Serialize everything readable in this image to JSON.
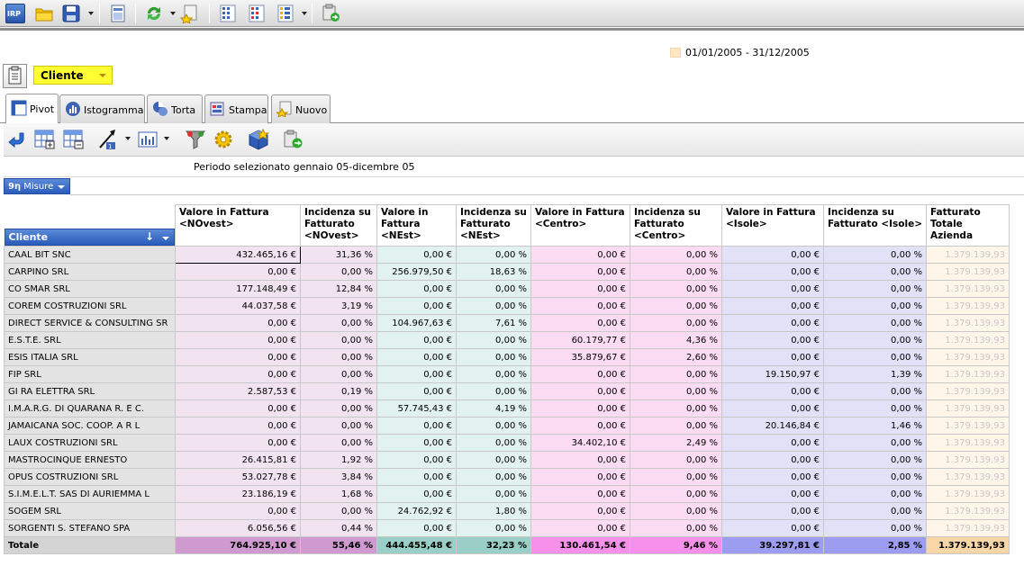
{
  "toolbar": {
    "icons": [
      "irp-logo-icon",
      "open-folder-icon",
      "save-icon",
      "document-icon",
      "refresh-icon",
      "new-star-icon",
      "grid-blue-icon",
      "grid-red-icon",
      "grid-yellow-icon",
      "export-icon"
    ],
    "irp_label": "IRP"
  },
  "period_legend": "01/01/2005 - 31/12/2005",
  "dimension": {
    "selected": "Cliente"
  },
  "tabs": [
    {
      "label": "Pivot",
      "icon": "pivot-table-icon",
      "active": true
    },
    {
      "label": "Istogramma",
      "icon": "bar-chart-icon"
    },
    {
      "label": "Torta",
      "icon": "pie-chart-icon"
    },
    {
      "label": "Stampa",
      "icon": "print-icon"
    },
    {
      "label": "Nuovo",
      "icon": "new-star-icon"
    }
  ],
  "pivot_toolbar_icons": [
    "back-arrow-icon",
    "add-column-icon",
    "remove-column-icon",
    "drill-icon",
    "chart-options-icon",
    "filter-icon",
    "settings-gear-icon",
    "cube-icon",
    "export-icon"
  ],
  "period_text": "Periodo selezionato  gennaio 05-dicembre 05",
  "measures_label": "Misure",
  "measures_prefix": "9η",
  "grid": {
    "dimension_header": "Cliente",
    "columns": [
      "Valore in Fattura <NOvest>",
      "Incidenza su Fatturato <NOvest>",
      "Valore in Fattura <NEst>",
      "Incidenza su Fatturato <NEst>",
      "Valore in Fattura <Centro>",
      "Incidenza su Fatturato <Centro>",
      "Valore in Fattura <Isole>",
      "Incidenza su Fatturato <Isole>",
      "Fatturato Totale Azienda"
    ],
    "rows": [
      {
        "name": "CAAL BIT SNC",
        "values": [
          "432.465,16 €",
          "31,36 %",
          "0,00 €",
          "0,00 %",
          "0,00 €",
          "0,00 %",
          "0,00 €",
          "0,00 %",
          "1.379.139,93"
        ]
      },
      {
        "name": "CARPINO SRL",
        "values": [
          "0,00 €",
          "0,00 %",
          "256.979,50 €",
          "18,63 %",
          "0,00 €",
          "0,00 %",
          "0,00 €",
          "0,00 %",
          "1.379.139,93"
        ]
      },
      {
        "name": "CO SMAR SRL",
        "values": [
          "177.148,49 €",
          "12,84 %",
          "0,00 €",
          "0,00 %",
          "0,00 €",
          "0,00 %",
          "0,00 €",
          "0,00 %",
          "1.379.139,93"
        ]
      },
      {
        "name": "COREM COSTRUZIONI SRL",
        "values": [
          "44.037,58 €",
          "3,19 %",
          "0,00 €",
          "0,00 %",
          "0,00 €",
          "0,00 %",
          "0,00 €",
          "0,00 %",
          "1.379.139,93"
        ]
      },
      {
        "name": "DIRECT SERVICE & CONSULTING SR",
        "values": [
          "0,00 €",
          "0,00 %",
          "104.967,63 €",
          "7,61 %",
          "0,00 €",
          "0,00 %",
          "0,00 €",
          "0,00 %",
          "1.379.139,93"
        ]
      },
      {
        "name": "E.S.T.E. SRL",
        "values": [
          "0,00 €",
          "0,00 %",
          "0,00 €",
          "0,00 %",
          "60.179,77 €",
          "4,36 %",
          "0,00 €",
          "0,00 %",
          "1.379.139,93"
        ]
      },
      {
        "name": "ESIS ITALIA SRL",
        "values": [
          "0,00 €",
          "0,00 %",
          "0,00 €",
          "0,00 %",
          "35.879,67 €",
          "2,60 %",
          "0,00 €",
          "0,00 %",
          "1.379.139,93"
        ]
      },
      {
        "name": "FIP SRL",
        "values": [
          "0,00 €",
          "0,00 %",
          "0,00 €",
          "0,00 %",
          "0,00 €",
          "0,00 %",
          "19.150,97 €",
          "1,39 %",
          "1.379.139,93"
        ]
      },
      {
        "name": "GI RA ELETTRA SRL",
        "values": [
          "2.587,53 €",
          "0,19 %",
          "0,00 €",
          "0,00 %",
          "0,00 €",
          "0,00 %",
          "0,00 €",
          "0,00 %",
          "1.379.139,93"
        ]
      },
      {
        "name": "I.M.A.R.G. DI QUARANA R. E C.",
        "values": [
          "0,00 €",
          "0,00 %",
          "57.745,43 €",
          "4,19 %",
          "0,00 €",
          "0,00 %",
          "0,00 €",
          "0,00 %",
          "1.379.139,93"
        ]
      },
      {
        "name": "JAMAICANA SOC. COOP. A R L",
        "values": [
          "0,00 €",
          "0,00 %",
          "0,00 €",
          "0,00 %",
          "0,00 €",
          "0,00 %",
          "20.146,84 €",
          "1,46 %",
          "1.379.139,93"
        ]
      },
      {
        "name": "LAUX COSTRUZIONI SRL",
        "values": [
          "0,00 €",
          "0,00 %",
          "0,00 €",
          "0,00 %",
          "34.402,10 €",
          "2,49 %",
          "0,00 €",
          "0,00 %",
          "1.379.139,93"
        ]
      },
      {
        "name": "MASTROCINQUE ERNESTO",
        "values": [
          "26.415,81 €",
          "1,92 %",
          "0,00 €",
          "0,00 %",
          "0,00 €",
          "0,00 %",
          "0,00 €",
          "0,00 %",
          "1.379.139,93"
        ]
      },
      {
        "name": "OPUS COSTRUZIONI SRL",
        "values": [
          "53.027,78 €",
          "3,84 %",
          "0,00 €",
          "0,00 %",
          "0,00 €",
          "0,00 %",
          "0,00 €",
          "0,00 %",
          "1.379.139,93"
        ]
      },
      {
        "name": "S.I.M.E.L.T. SAS DI AURIEMMA L",
        "values": [
          "23.186,19 €",
          "1,68 %",
          "0,00 €",
          "0,00 %",
          "0,00 €",
          "0,00 %",
          "0,00 €",
          "0,00 %",
          "1.379.139,93"
        ]
      },
      {
        "name": "SOGEM SRL",
        "values": [
          "0,00 €",
          "0,00 %",
          "24.762,92 €",
          "1,80 %",
          "0,00 €",
          "0,00 %",
          "0,00 €",
          "0,00 %",
          "1.379.139,93"
        ]
      },
      {
        "name": "SORGENTI S. STEFANO SPA",
        "values": [
          "6.056,56 €",
          "0,44 %",
          "0,00 €",
          "0,00 %",
          "0,00 €",
          "0,00 %",
          "0,00 €",
          "0,00 %",
          "1.379.139,93"
        ]
      }
    ],
    "total": {
      "name": "Totale",
      "values": [
        "764.925,10 €",
        "55,46 %",
        "444.455,48 €",
        "32,23 %",
        "130.461,54 €",
        "9,46 %",
        "39.297,81 €",
        "2,85 %",
        "1.379.139,93"
      ]
    }
  },
  "colors": {
    "novest_cell": "#f2e3f0",
    "nest_cell": "#e2f2ee",
    "centro_cell": "#fbdcf3",
    "isole_cell": "#e1e1f8",
    "totale_cell": "#fff6ea",
    "novest_total": "#cf9ad0",
    "nest_total": "#99cfc6",
    "centro_total": "#f790ea",
    "isole_total": "#9c9cf0",
    "totale_total": "#f9d6a8",
    "selector_yellow": "#ffff33",
    "header_blue": "#2a5cba"
  }
}
